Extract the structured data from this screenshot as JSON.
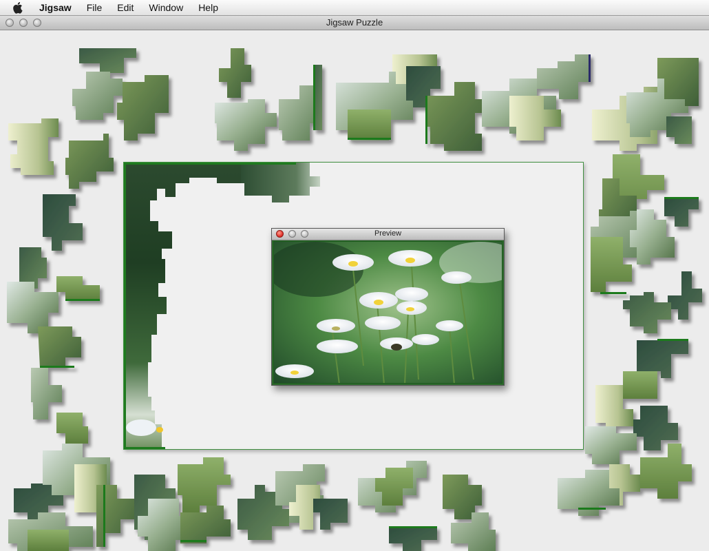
{
  "menubar": {
    "apple_icon": "apple-logo-icon",
    "items": [
      "Jigsaw",
      "File",
      "Edit",
      "Window",
      "Help"
    ]
  },
  "window": {
    "title": "Jigsaw Puzzle"
  },
  "preview": {
    "title": "Preview"
  },
  "colors": {
    "board_border": "#3f8f3f",
    "piece_edge": "#1f7a1f",
    "close_button": "#e0302a"
  }
}
